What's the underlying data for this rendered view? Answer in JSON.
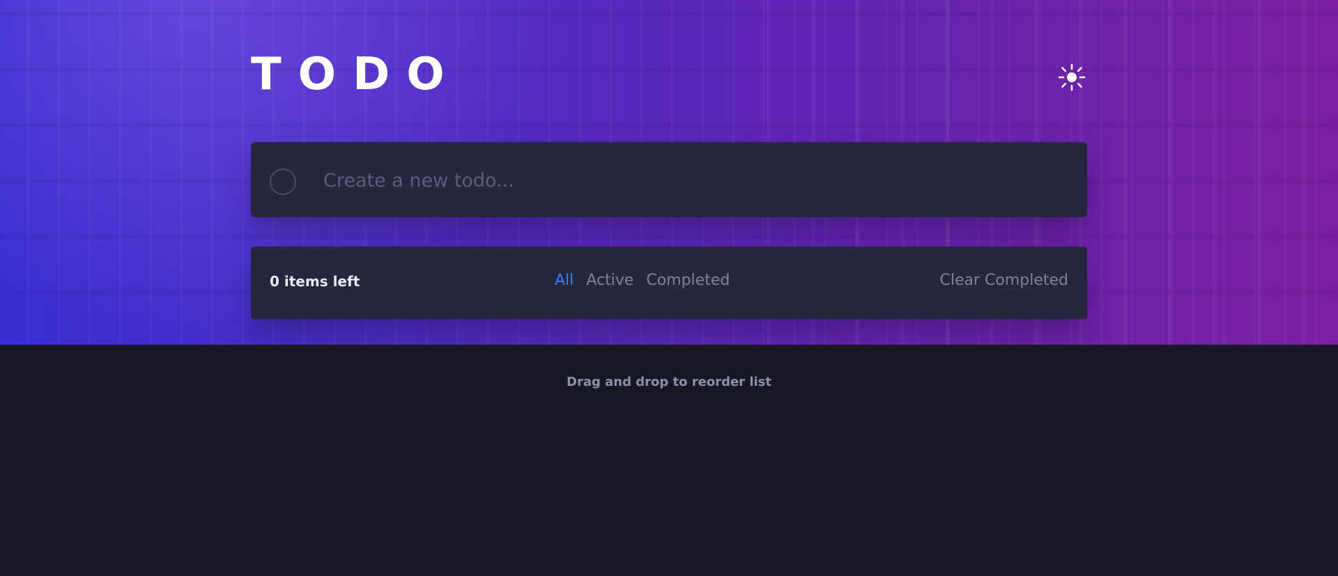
{
  "header": {
    "title": "TODO",
    "theme_icon": "sun-icon"
  },
  "new_todo": {
    "placeholder": "Create a new todo...",
    "value": ""
  },
  "footer": {
    "items_left": "0 items left",
    "filters": [
      {
        "label": "All",
        "active": true
      },
      {
        "label": "Active",
        "active": false
      },
      {
        "label": "Completed",
        "active": false
      }
    ],
    "clear_completed_label": "Clear Completed"
  },
  "hint": {
    "text": "Drag and drop to reorder list"
  },
  "colors": {
    "background": "#181824",
    "card": "#25273c",
    "accent": "#3a7bfd",
    "muted_text": "#7f829f",
    "hero_gradient_left": "#3a2ed0",
    "hero_gradient_right": "#7a1f9f"
  }
}
